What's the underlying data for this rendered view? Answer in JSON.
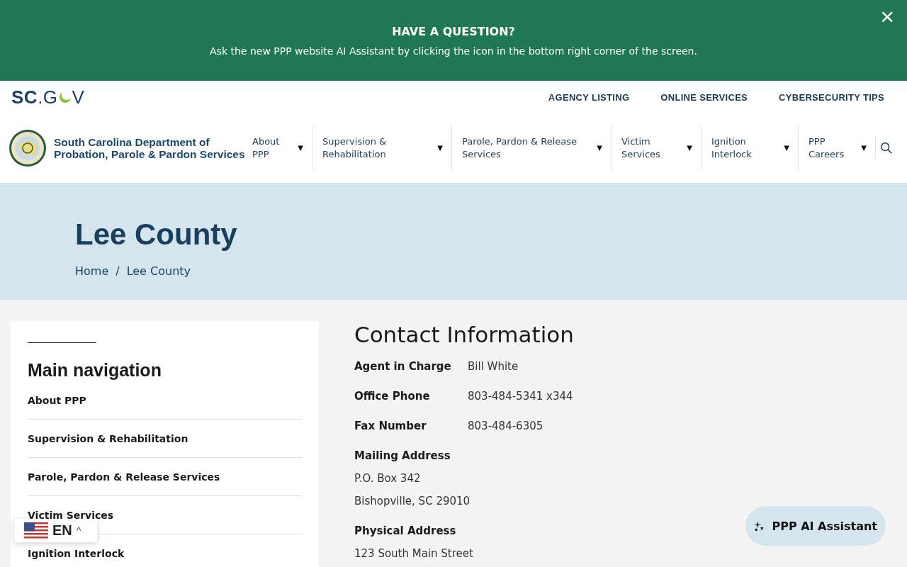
{
  "banner": {
    "title": "HAVE A QUESTION?",
    "text": "Ask the new PPP website AI Assistant by clicking the icon in the bottom right corner of the screen.",
    "close": "×"
  },
  "scgov": {
    "bold": "SC",
    "before": ".G",
    "after": "V"
  },
  "top_links": [
    "AGENCY LISTING",
    "ONLINE SERVICES",
    "CYBERSECURITY TIPS"
  ],
  "agency": {
    "line1": "South Carolina Department of",
    "line2": "Probation, Parole & Pardon Services"
  },
  "nav": [
    {
      "label": "About PPP",
      "caret": "▼"
    },
    {
      "label": "Supervision & Rehabilitation",
      "caret": "▼"
    },
    {
      "label": "Parole, Pardon & Release Services",
      "caret": "▼"
    },
    {
      "label": "Victim Services",
      "caret": "▼"
    },
    {
      "label": "Ignition Interlock",
      "caret": "▼"
    },
    {
      "label": "PPP Careers",
      "caret": "▼"
    }
  ],
  "hero": {
    "title": "Lee County",
    "breadcrumb": [
      "Home",
      "Lee County"
    ],
    "separator": "/"
  },
  "sidebar": {
    "title": "Main navigation",
    "items": [
      "About PPP",
      "Supervision & Rehabilitation",
      "Parole, Pardon & Release Services",
      "Victim Services",
      "Ignition Interlock"
    ]
  },
  "contact": {
    "title": "Contact Information",
    "rows": [
      {
        "kind": "inline",
        "label": "Agent in Charge",
        "lines": [
          "Bill White"
        ]
      },
      {
        "kind": "inline",
        "label": "Office Phone",
        "lines": [
          "803-484-5341 x344"
        ]
      },
      {
        "kind": "inline",
        "label": "Fax Number",
        "lines": [
          "803-484-6305"
        ]
      },
      {
        "kind": "block",
        "label": "Mailing Address",
        "lines": [
          "P.O. Box 342",
          "Bishopville, SC 29010"
        ]
      },
      {
        "kind": "block",
        "label": "Physical Address",
        "lines": [
          "123 South Main Street"
        ]
      }
    ]
  },
  "language": {
    "code": "EN",
    "caret": "^"
  },
  "assistant": {
    "label": "PPP AI Assistant"
  }
}
